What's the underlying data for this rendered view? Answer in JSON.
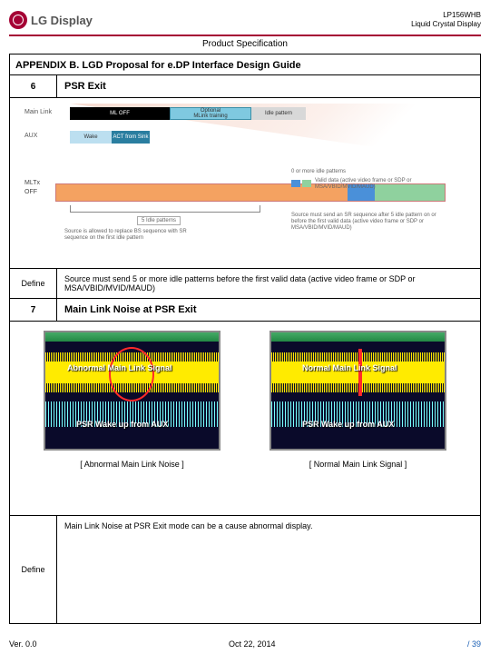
{
  "header": {
    "brand": "LG Display",
    "model": "LP156WHB",
    "product_type": "Liquid Crystal Display",
    "spec_title": "Product Specification"
  },
  "appendix": {
    "title": "APPENDIX B. LGD Proposal for e.DP Interface Design Guide"
  },
  "section6": {
    "num": "6",
    "title": "PSR Exit",
    "define_label": "Define",
    "define_text": "Source must send 5 or more idle patterns before the first valid data (active video frame or SDP or MSA/VBID/MVID/MAUD)"
  },
  "diagram": {
    "main_link_label": "Main Link",
    "aux_label": "AUX",
    "ml_off": "ML OFF",
    "ml_opt_line1": "Optional",
    "ml_opt_line2": "MLink training",
    "ml_idle": "Idle pattern",
    "aux_wake": "Wake",
    "aux_sink": "ACT from Sink",
    "mltx": "MLTx",
    "off": "OFF",
    "idle_patterns_box": "5 Idle patterns",
    "note_top": "0 or more idle patterns",
    "legend_valid": "Valid data (active video frame or SDP or MSA/VBID/MVID/MAUD)",
    "note_right": "Source must send an SR sequence after 5 idle pattern on or before the first valid data (active video frame or SDP or MSA/VBID/MVID/MAUD)",
    "note_left": "Source is allowed to replace BS sequence with SR sequence on the first idle pattern"
  },
  "section7": {
    "num": "7",
    "title": "Main Link Noise at PSR Exit",
    "define_label": "Define",
    "define_text": "Main Link Noise at PSR Exit mode can be a cause abnormal display."
  },
  "scopes": {
    "left": {
      "overlay_top": "Abnormal Main Link Signal",
      "overlay_bottom": "PSR Wake up from AUX",
      "caption": "[ Abnormal Main Link Noise ]"
    },
    "right": {
      "overlay_top": "Normal Main Link Signal",
      "overlay_bottom": "PSR Wake up from AUX",
      "caption": "[ Normal Main Link Signal ]"
    }
  },
  "footer": {
    "version": "Ver. 0.0",
    "date": "Oct 22, 2014",
    "page": "/ 39"
  }
}
